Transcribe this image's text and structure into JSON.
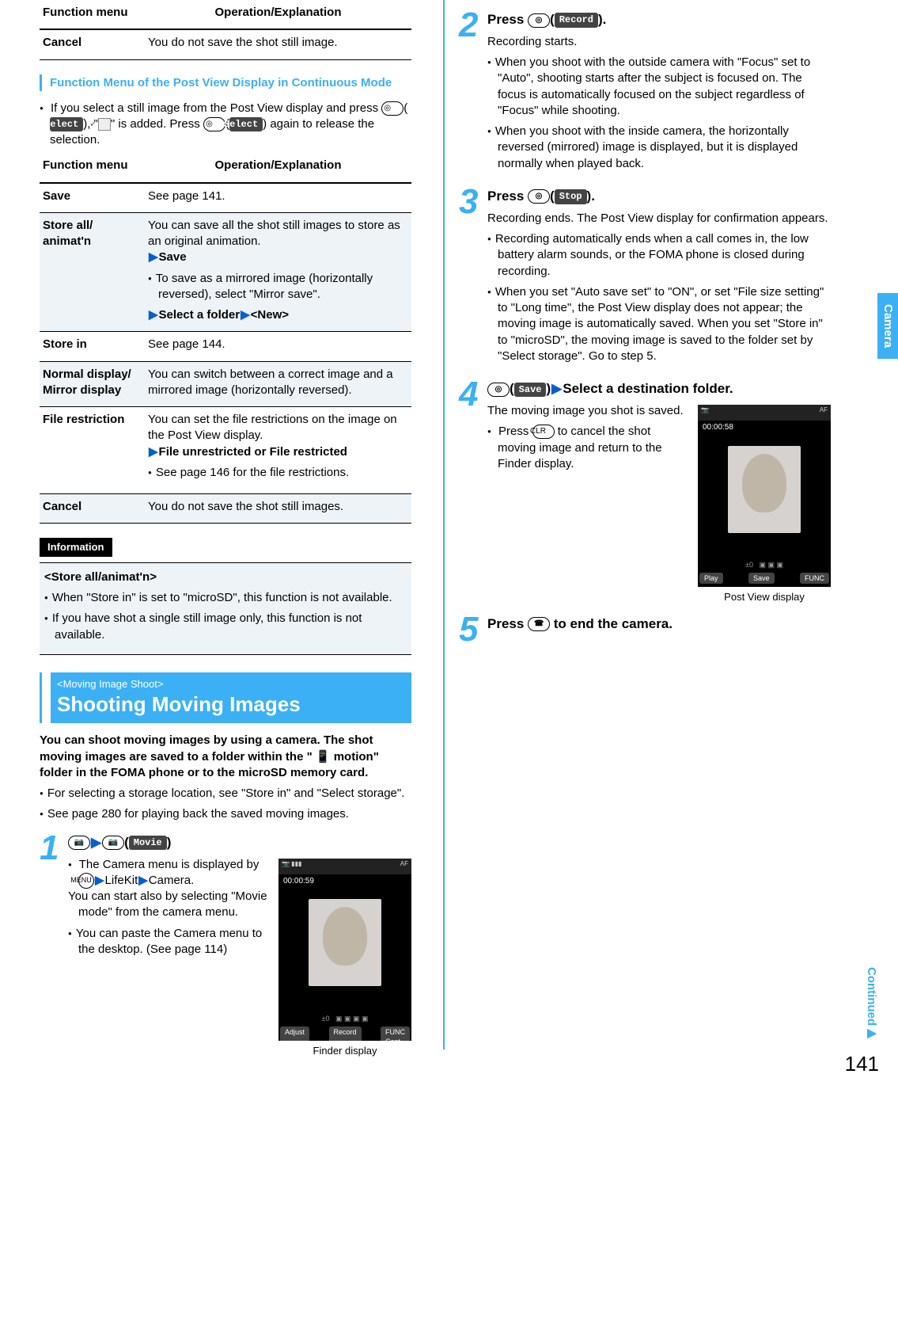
{
  "page_number": "141",
  "sidetab": "Camera",
  "continued": "Continued",
  "table1": {
    "head": {
      "c1": "Function menu",
      "c2": "Operation/Explanation"
    },
    "rows": [
      {
        "fn": "Cancel",
        "desc": "You do not save the shot still image."
      }
    ]
  },
  "subhead_postview": "Function Menu of the Post View Display in Continuous Mode",
  "postview_intro_a": "If you select a still image from the Post View display and press ",
  "postview_intro_b": "), \"",
  "postview_intro_c": "\" is added. Press ",
  "postview_intro_d": ") again to release the selection.",
  "btn_select": "Select",
  "table2": {
    "head": {
      "c1": "Function menu",
      "c2": "Operation/Explanation"
    },
    "rows": [
      {
        "fn": "Save",
        "desc": "See page 141.",
        "shade": false
      },
      {
        "fn": "Store all/ animat'n",
        "shade": true,
        "d1": "You can save all the shot still images to store as an original animation.",
        "d2": "Save",
        "d3": "To save as a mirrored image (horizontally reversed), select \"Mirror save\".",
        "d4a": "Select a folder",
        "d4b": "<New>"
      },
      {
        "fn": "Store in",
        "desc": "See page 144.",
        "shade": false
      },
      {
        "fn": "Normal display/ Mirror display",
        "desc": "You can switch between a correct image and a mirrored image (horizontally reversed).",
        "shade": true
      },
      {
        "fn": "File restriction",
        "shade": false,
        "d1": "You can set the file restrictions on the image on the Post View display.",
        "d2": "File unrestricted or File restricted",
        "d3": "See page 146 for the file restrictions."
      },
      {
        "fn": "Cancel",
        "desc": "You do not save the shot still images.",
        "shade": true
      }
    ]
  },
  "info_label": "Information",
  "info_title": "<Store all/animat'n>",
  "info_b1": "When \"Store in\" is set to \"microSD\", this function is not available.",
  "info_b2": "If you have shot a single still image only, this function is not available.",
  "moving_head_sub": "<Moving Image Shoot>",
  "moving_head_main": "Shooting Moving Images",
  "moving_intro_bold": "You can shoot moving images by using a camera. The shot moving images are saved to a folder within the \" 📱 motion\" folder in the FOMA phone or to the microSD memory card.",
  "moving_b1": "For selecting a storage location, see \"Store in\" and \"Select storage\".",
  "moving_b2": "See page 280 for playing back the saved moving images.",
  "step1": {
    "num": "1",
    "btn_movie": "Movie",
    "b1a": "The Camera menu is displayed by ",
    "b1_menu": "MENU",
    "b1b": "LifeKit",
    "b1c": "Camera.",
    "b1_more": "You can start also by selecting \"Movie mode\" from the camera menu.",
    "b2": "You can paste the Camera menu to the desktop. (See page 114)",
    "caption": "Finder display",
    "shot": {
      "timer": "00:00:59",
      "soft_l": "Adjust",
      "soft_c": "Record",
      "soft_r": "FUNC\nCont.",
      "top_r": "AF"
    }
  },
  "step2": {
    "num": "2",
    "title_a": "Press ",
    "btn": "Record",
    "title_b": ").",
    "d1": "Recording starts.",
    "b1": "When you shoot with the outside camera with \"Focus\" set to \"Auto\", shooting starts after the subject is focused on. The focus is automatically focused on the subject regardless of \"Focus\" while shooting.",
    "b2": "When you shoot with the inside camera, the horizontally reversed (mirrored) image is displayed, but it is displayed normally when played back."
  },
  "step3": {
    "num": "3",
    "title_a": "Press ",
    "btn": "Stop",
    "title_b": ").",
    "d1": "Recording ends. The Post View display for confirmation appears.",
    "b1": "Recording automatically ends when a call comes in, the low battery alarm sounds, or the FOMA phone is closed during recording.",
    "b2": "When you set \"Auto save set\" to \"ON\", or set \"File size setting\" to \"Long time\", the Post View display does not appear; the moving image is automatically saved. When you set \"Store in\" to \"microSD\", the moving image is saved to the folder set by \"Select storage\". Go to step 5."
  },
  "step4": {
    "num": "4",
    "btn": "Save",
    "title_b": "Select a destination folder.",
    "d1": "The moving image you shot is saved.",
    "b1a": "Press ",
    "b1_key": "CLR",
    "b1b": " to cancel the shot moving image and return to the Finder display.",
    "caption": "Post View display",
    "shot": {
      "timer": "00:00:58",
      "soft_l": "Play",
      "soft_c": "Save",
      "soft_r": "FUNC",
      "top_r": "AF"
    }
  },
  "step5": {
    "num": "5",
    "title_a": "Press ",
    "key": "☎",
    "title_b": " to end the camera."
  }
}
